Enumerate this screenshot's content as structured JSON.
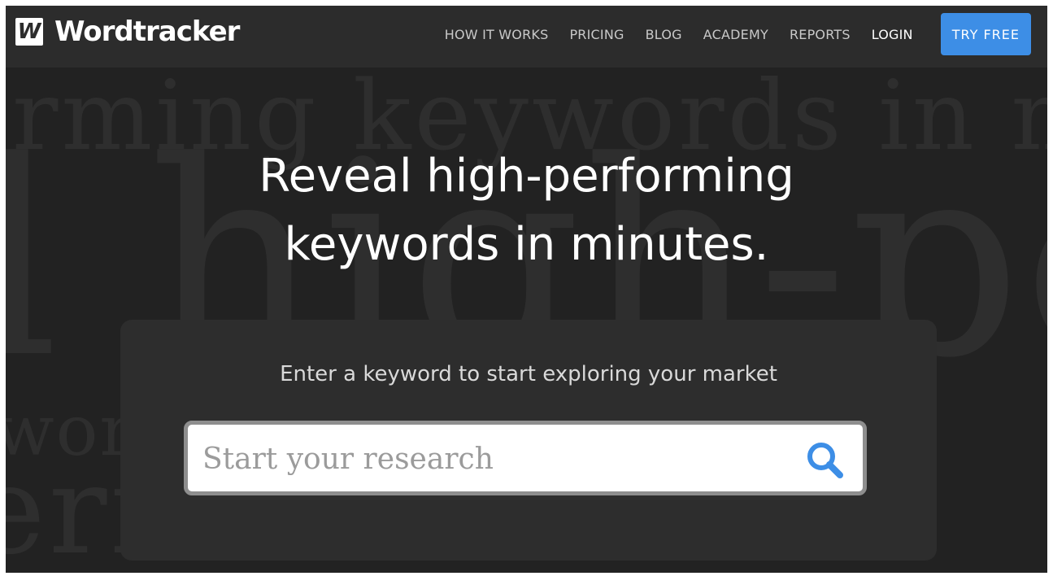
{
  "brand": {
    "logo_mark": "W",
    "name": "Wordtracker"
  },
  "nav": {
    "items": [
      {
        "label": "HOW IT WORKS"
      },
      {
        "label": "PRICING"
      },
      {
        "label": "BLOG"
      },
      {
        "label": "ACADEMY"
      },
      {
        "label": "REPORTS"
      },
      {
        "label": "LOGIN"
      }
    ],
    "cta": "TRY FREE"
  },
  "hero": {
    "background_lines": [
      "rming keywords in minutes",
      "l high-pe",
      "words                                                              ng ke",
      "erfo                                    s in"
    ],
    "headline_line1": "Reveal high-performing",
    "headline_line2": "keywords in minutes."
  },
  "search": {
    "prompt": "Enter a keyword to start exploring your market",
    "placeholder": "Start your research",
    "value": "",
    "icon": "search-icon"
  },
  "colors": {
    "accent": "#3d8ee6",
    "header_bg": "#2c2c2c",
    "page_bg": "#222222",
    "panel_bg": "#2d2d2d"
  }
}
